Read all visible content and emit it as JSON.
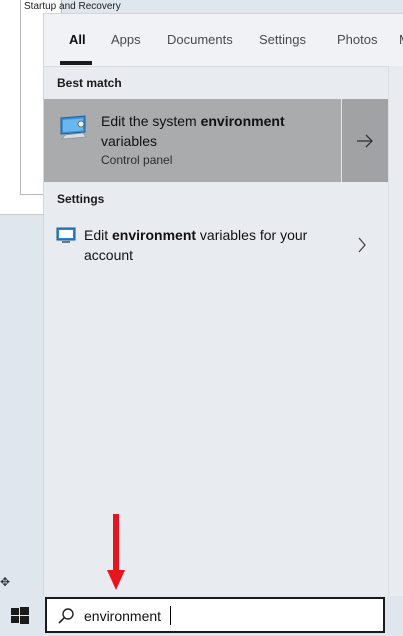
{
  "background_window": {
    "partial_text": "Startup and Recovery"
  },
  "tabs": [
    {
      "label": "All",
      "active": true
    },
    {
      "label": "Apps"
    },
    {
      "label": "Documents"
    },
    {
      "label": "Settings"
    },
    {
      "label": "Photos"
    },
    {
      "label": "M"
    }
  ],
  "best_match": {
    "section_label": "Best match",
    "title_before": "Edit the system ",
    "title_bold": "environment",
    "title_after": " variables",
    "subtitle": "Control panel",
    "icon": "monitor-settings-icon"
  },
  "settings_section": {
    "section_label": "Settings",
    "item_before": "Edit ",
    "item_bold": "environment",
    "item_after": " variables for your account",
    "icon": "monitor-icon"
  },
  "search": {
    "value": "environment"
  },
  "colors": {
    "selected_result": "#a9abad",
    "annotation_arrow": "#e8141b"
  }
}
